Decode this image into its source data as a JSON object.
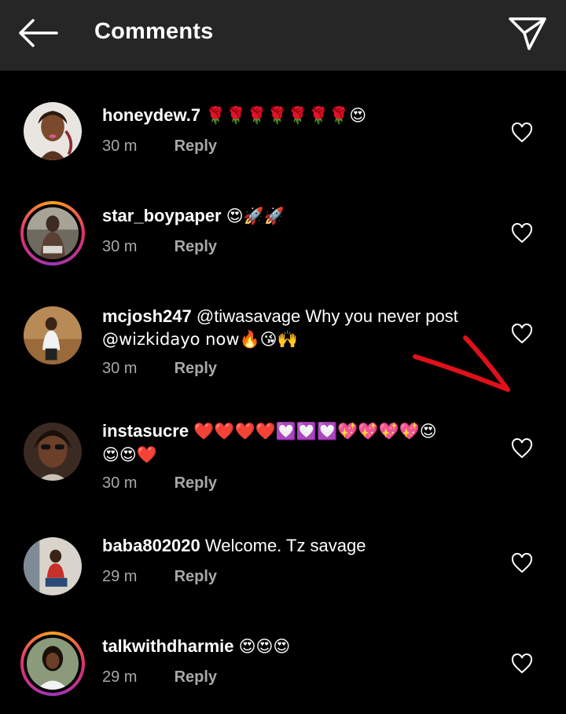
{
  "header": {
    "title": "Comments",
    "back_icon": "back-arrow-icon",
    "send_icon": "direct-send-icon"
  },
  "comments": [
    {
      "username": "honeydew.7",
      "text": "🌹🌹🌹🌹🌹🌹🌹😍",
      "time": "30 m",
      "reply": "Reply",
      "story_ring": false
    },
    {
      "username": "star_boypaper",
      "text": "😍🚀🚀",
      "time": "30 m",
      "reply": "Reply",
      "story_ring": true
    },
    {
      "username": "mcjosh247",
      "text_line1": "@tiwasavage Why you never post",
      "text_line2": "@wizkidayo now🔥😘🙌",
      "time": "30 m",
      "reply": "Reply",
      "story_ring": false
    },
    {
      "username": "instasucre",
      "text_line1": "❤️❤️❤️❤️💟💟💟💖💖💖💖😍",
      "text_line2": "😍😍❤️",
      "time": "30 m",
      "reply": "Reply",
      "story_ring": false
    },
    {
      "username": "baba802020",
      "text": "Welcome. Tz savage",
      "time": "29 m",
      "reply": "Reply",
      "story_ring": false
    },
    {
      "username": "talkwithdharmie",
      "text": "😍😍😍",
      "time": "29 m",
      "reply": "Reply",
      "story_ring": true
    }
  ],
  "colors": {
    "header_bg": "#262626",
    "meta_text": "#a8a8a8",
    "annotation_red": "#e0101a"
  }
}
